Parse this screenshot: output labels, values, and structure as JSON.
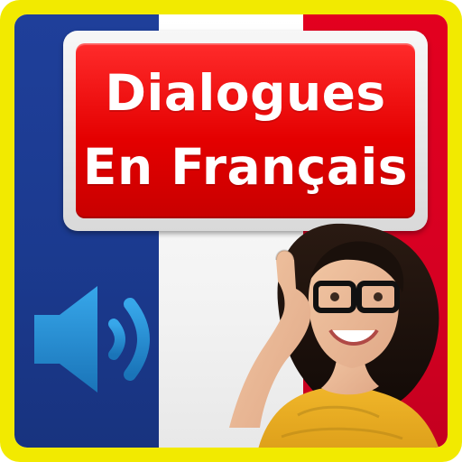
{
  "app_icon": {
    "title": {
      "line1": "Dialogues",
      "line2": "En Français"
    },
    "colors": {
      "frame": "#f2ea00",
      "flag_blue": "#1f3f9a",
      "flag_white": "#ffffff",
      "flag_red": "#e3001f",
      "plate_red": "#e40000",
      "speaker_blue": "#1e86c8"
    },
    "icons": {
      "speaker": "speaker-volume-icon"
    }
  }
}
